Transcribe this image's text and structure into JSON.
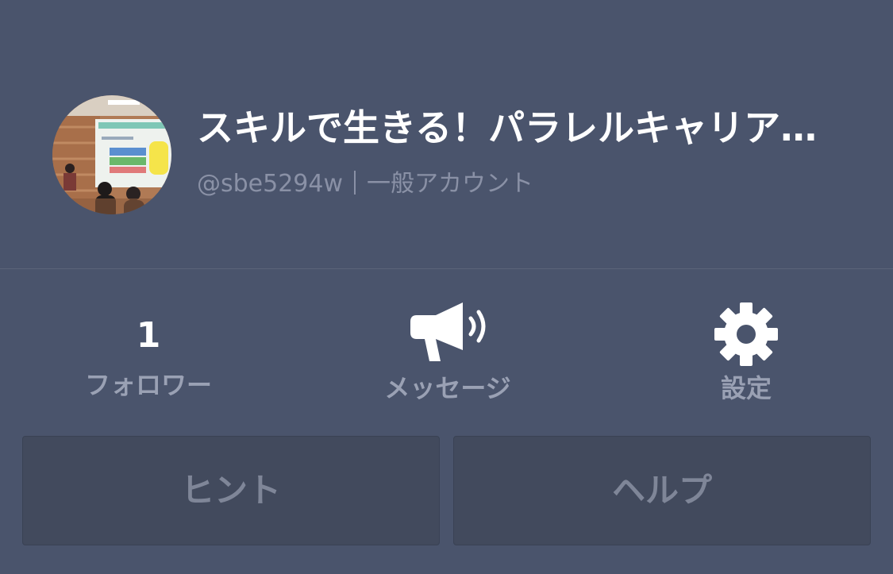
{
  "profile": {
    "name": "スキルで生きる！パラレルキャリア…",
    "handle": "@sbe5294w",
    "account_type": "一般アカウント",
    "avatar_icon": "profile-photo"
  },
  "stats": {
    "followers_count": "1",
    "followers_label": "フォロワー",
    "message_label": "メッセージ",
    "message_icon": "megaphone-icon",
    "settings_label": "設定",
    "settings_icon": "gear-icon"
  },
  "buttons": {
    "hint_label": "ヒント",
    "help_label": "ヘルプ"
  },
  "colors": {
    "background": "#4a546c",
    "button_background": "#424a5d",
    "muted_text": "#8a91a6",
    "primary_text": "#ffffff"
  }
}
